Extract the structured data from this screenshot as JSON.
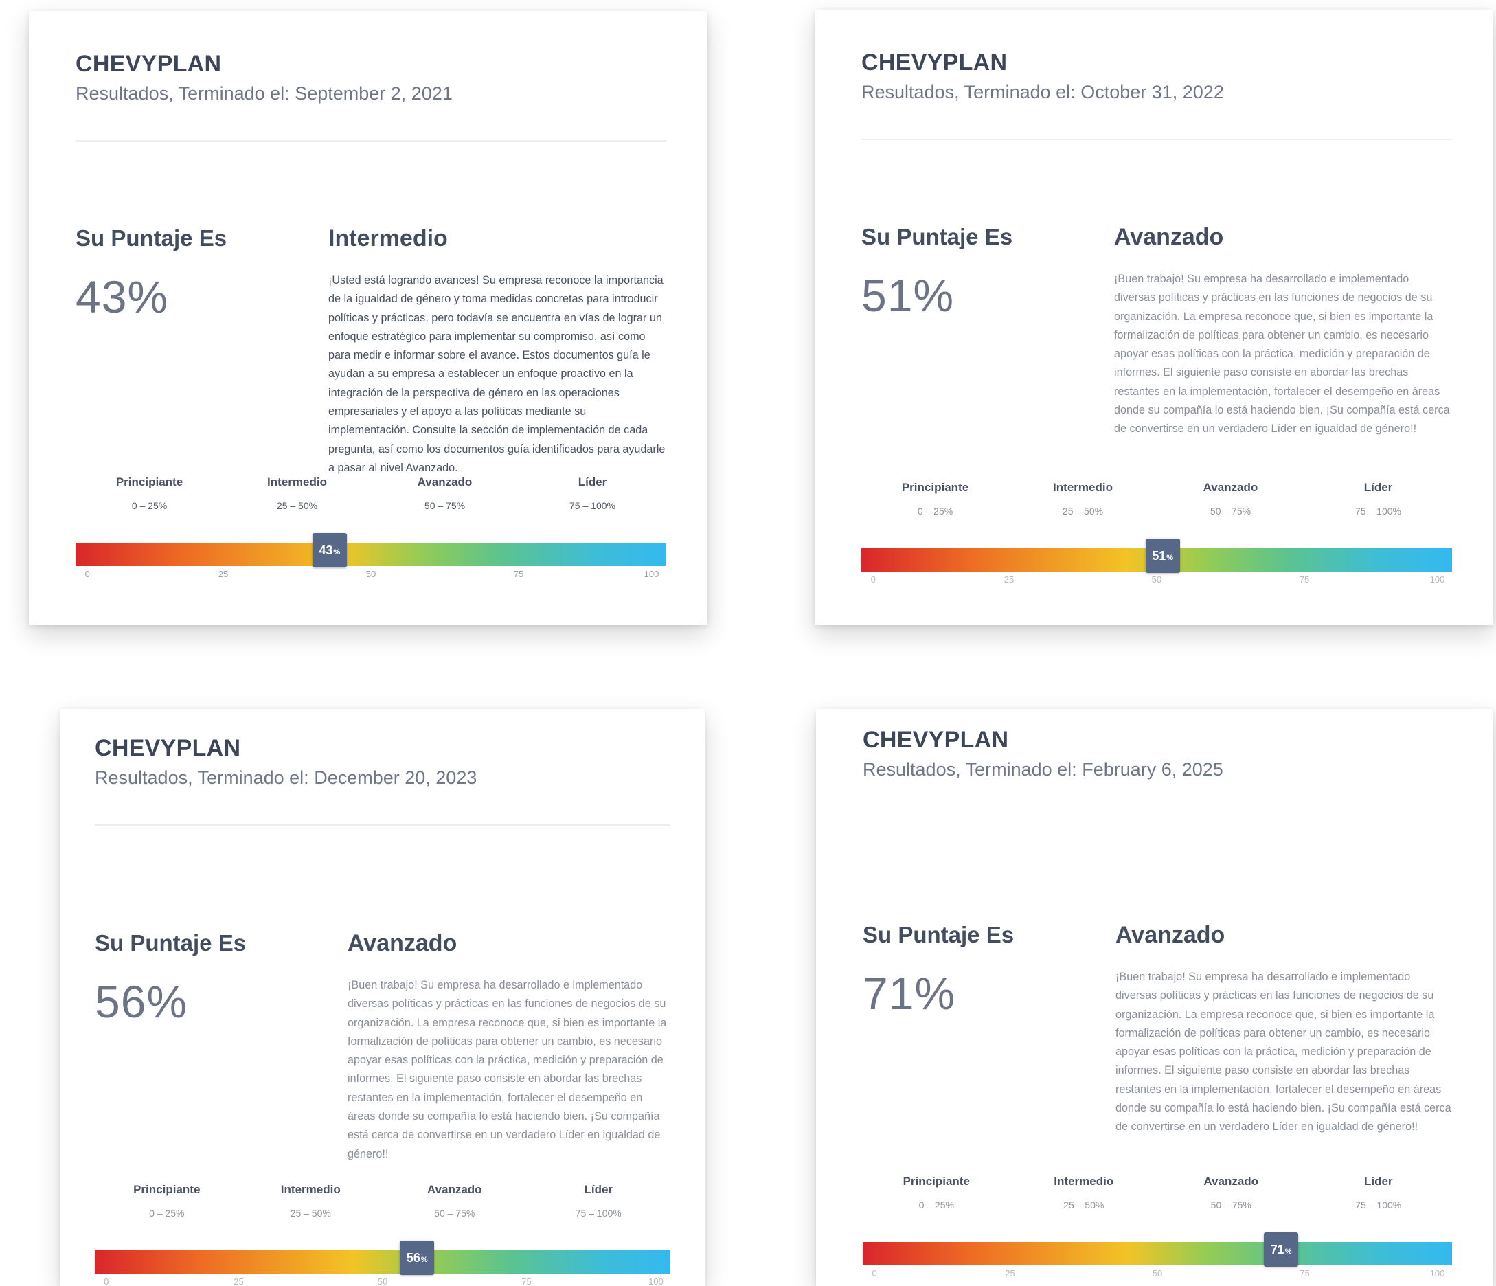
{
  "scale": {
    "ticks": [
      "0",
      "25",
      "50",
      "75",
      "100"
    ],
    "tick_values": [
      0,
      25,
      50,
      75,
      100
    ]
  },
  "levels": [
    {
      "name": "Principiante",
      "range": "0 – 25%"
    },
    {
      "name": "Intermedio",
      "range": "25 – 50%"
    },
    {
      "name": "Avanzado",
      "range": "50 – 75%"
    },
    {
      "name": "Líder",
      "range": "75 – 100%"
    }
  ],
  "cards": [
    {
      "company": "CHEVYPLAN",
      "subtitle_prefix": "Resultados, Terminado el:",
      "date": "September 2, 2021",
      "score_heading": "Su Puntaje Es",
      "score": "43%",
      "score_value": 43,
      "marker_label": "43",
      "level_title": "Intermedio",
      "description": "¡Usted está logrando avances! Su empresa reconoce la importancia de la igualdad de género y toma medidas concretas para introducir políticas y prácticas, pero todavía se encuentra en vías de lograr un enfoque estratégico para implementar su compromiso, así como para medir e informar sobre el avance. Estos documentos guía le ayudan a su empresa a establecer un enfoque proactivo en la integración de la perspectiva de género en las operaciones empresariales y el apoyo a las políticas mediante su implementación. Consulte la sección de implementación de cada pregunta, así como los documentos guía identificados para ayudarle a pasar al nivel Avanzado."
    },
    {
      "company": "CHEVYPLAN",
      "subtitle_prefix": "Resultados, Terminado el:",
      "date": "October 31, 2022",
      "score_heading": "Su Puntaje Es",
      "score": "51%",
      "score_value": 51,
      "marker_label": "51",
      "level_title": "Avanzado",
      "description": "¡Buen trabajo! Su empresa ha desarrollado e implementado diversas políticas y prácticas en las funciones de negocios de su organización. La empresa reconoce que, si bien es importante la formalización de políticas para obtener un cambio, es necesario apoyar esas políticas con la práctica, medición y preparación de informes. El siguiente paso consiste en abordar las brechas restantes en la implementación, fortalecer el desempeño en áreas donde su compañía lo está haciendo bien. ¡Su compañía está cerca de convertirse en un verdadero Líder en igualdad de género!!"
    },
    {
      "company": "CHEVYPLAN",
      "subtitle_prefix": "Resultados, Terminado el:",
      "date": "December 20, 2023",
      "score_heading": "Su Puntaje Es",
      "score": "56%",
      "score_value": 56,
      "marker_label": "56",
      "level_title": "Avanzado",
      "description": "¡Buen trabajo! Su empresa ha desarrollado e implementado diversas políticas y prácticas en las funciones de negocios de su organización. La empresa reconoce que, si bien es importante la formalización de políticas para obtener un cambio, es necesario apoyar esas políticas con la práctica, medición y preparación de informes. El siguiente paso consiste en abordar las brechas restantes en la implementación, fortalecer el desempeño en áreas donde su compañía lo está haciendo bien. ¡Su compañía está cerca de convertirse en un verdadero Líder en igualdad de género!!"
    },
    {
      "company": "CHEVYPLAN",
      "subtitle_prefix": "Resultados, Terminado el:",
      "date": "February 6, 2025",
      "score_heading": "Su Puntaje Es",
      "score": "71%",
      "score_value": 71,
      "marker_label": "71",
      "level_title": "Avanzado",
      "description": "¡Buen trabajo! Su empresa ha desarrollado e implementado diversas políticas y prácticas en las funciones de negocios de su organización. La empresa reconoce que, si bien es importante la formalización de políticas para obtener un cambio, es necesario apoyar esas políticas con la práctica, medición y preparación de informes. El siguiente paso consiste en abordar las brechas restantes en la implementación, fortalecer el desempeño en áreas donde su compañía lo está haciendo bien. ¡Su compañía está cerca de convertirse en un verdadero Líder en igualdad de género!!"
    }
  ]
}
